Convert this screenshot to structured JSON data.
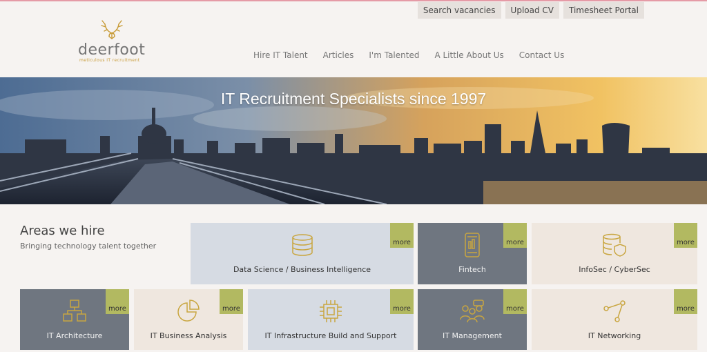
{
  "utility": {
    "search": "Search vacancies",
    "upload": "Upload CV",
    "timesheet": "Timesheet Portal"
  },
  "logo": {
    "brand": "deerfoot",
    "tagline": "meticulous IT recruitment",
    "brand_color": "#757575",
    "accent_color": "#c79a35"
  },
  "nav": [
    "Hire IT Talent",
    "Articles",
    "I'm Talented",
    "A Little About Us",
    "Contact Us"
  ],
  "hero": {
    "title": "IT Recruitment Specialists since 1997"
  },
  "areas": {
    "title": "Areas we hire",
    "subtitle": "Bringing technology talent together",
    "more_label": "more",
    "tiles": [
      {
        "label": "Data Science / Business Intelligence",
        "icon": "database-icon",
        "theme": "light"
      },
      {
        "label": "Fintech",
        "icon": "mobile-phone-icon",
        "theme": "gray"
      },
      {
        "label": "InfoSec / CyberSec",
        "icon": "database-shield-icon",
        "theme": "beige"
      },
      {
        "label": "IT Architecture",
        "icon": "network-architecture-icon",
        "theme": "gray"
      },
      {
        "label": "IT Business Analysis",
        "icon": "pie-chart-icon",
        "theme": "beige"
      },
      {
        "label": "IT Infrastructure Build and Support",
        "icon": "cpu-chip-icon",
        "theme": "light"
      },
      {
        "label": "IT Management",
        "icon": "team-meeting-icon",
        "theme": "gray"
      },
      {
        "label": "IT Networking",
        "icon": "network-nodes-icon",
        "theme": "beige"
      }
    ]
  },
  "colors": {
    "background": "#f6f3f1",
    "tile_gray": "#6f7680",
    "tile_light": "#d6dbe3",
    "tile_beige": "#efe7df",
    "more_badge": "#b2b961",
    "icon_gold": "#c9a640"
  }
}
